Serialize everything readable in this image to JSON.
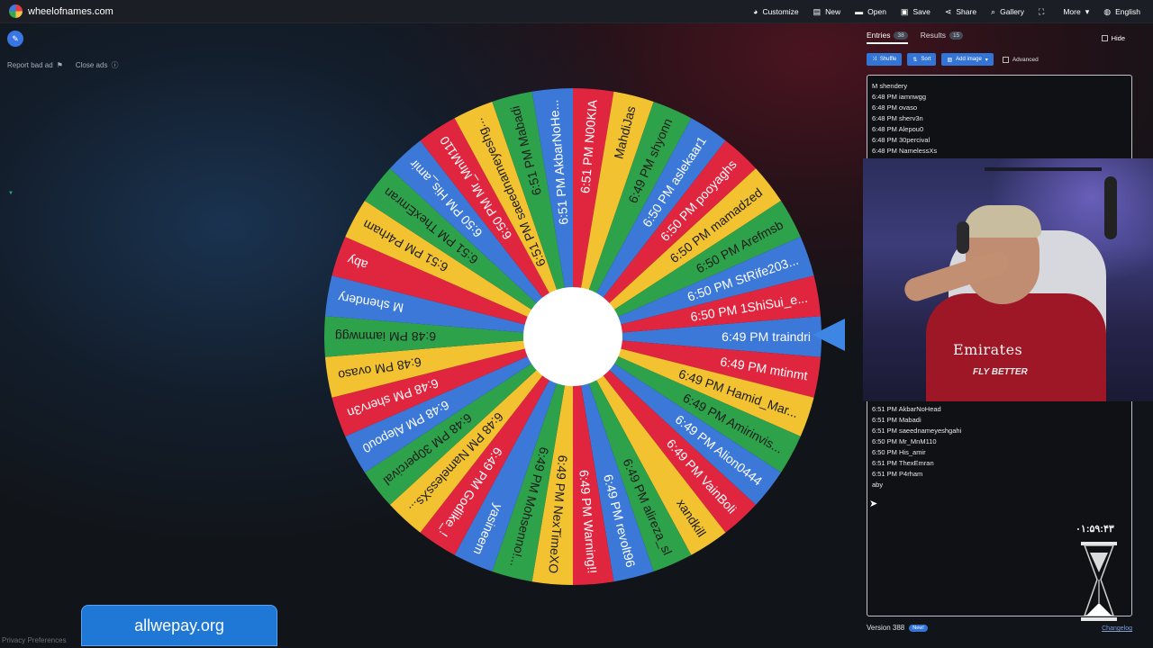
{
  "topbar": {
    "site_name": "wheelofnames.com",
    "menu": [
      {
        "label": "Customize",
        "icon": "palette-icon",
        "glyph": "◕"
      },
      {
        "label": "New",
        "icon": "document-icon",
        "glyph": "▤"
      },
      {
        "label": "Open",
        "icon": "folder-icon",
        "glyph": "▬"
      },
      {
        "label": "Save",
        "icon": "save-icon",
        "glyph": "▣"
      },
      {
        "label": "Share",
        "icon": "share-icon",
        "glyph": "⋖"
      },
      {
        "label": "Gallery",
        "icon": "search-icon",
        "glyph": "⌕"
      },
      {
        "label": "",
        "icon": "fullscreen-icon",
        "glyph": "⛶"
      },
      {
        "label": "More",
        "icon": "chevron-down-icon",
        "glyph": "▾"
      },
      {
        "label": "English",
        "icon": "globe-icon",
        "glyph": "◍"
      }
    ]
  },
  "left": {
    "report_label": "Report bad ad",
    "close_ads_label": "Close ads"
  },
  "wheel": {
    "pointer_color": "#3d86e4",
    "colors": [
      "#3b78d8",
      "#e0263f",
      "#f2c230",
      "#2ea14b"
    ],
    "segments": [
      "6:49 PM traindri",
      "6:49 PM mtinmt",
      "6:49 PM Hamid_Mar...",
      "6:49 PM Amirinvis...",
      "6:49 PM Alion0444",
      "6:49 PM VainBoli",
      "xandkill",
      "6:49 PM alireza_sl",
      "6:49 PM revolt96",
      "6:49 PM Warning!!",
      "6:49 PM NexTimeXO",
      "6:49 PM Mohsenno!...",
      "yasineem",
      "6:49 PM Godlike_!",
      "6:48 PM NamelessXs...",
      "6:48 PM 30percival",
      "6:48 PM Alepou0",
      "6:48 PM sherv3n",
      "6:48 PM ovaso",
      "6:48 PM iamnwgg",
      "M shendery",
      "aby",
      "6:51 PM P4rham",
      "6:51 PM ThexEmran",
      "6:50 PM His_amir",
      "6:50 PM Mr_MnM110",
      "6:51 PM saeednameyeshg...",
      "6:51 PM Mabadi",
      "6:51 PM AkbarNoHe...",
      "6:51 PM N00KIA",
      "MahdiJas",
      "6:49 PM shyonn",
      "6:50 PM aslekaar1",
      "6:50 PM pooyaghs",
      "6:50 PM mamadzed",
      "6:50 PM Arefmsb",
      "6:50 PM StRife203...",
      "6:50 PM 1ShiSui_e..."
    ]
  },
  "panel": {
    "tabs": [
      {
        "label": "Entries",
        "count": "38"
      },
      {
        "label": "Results",
        "count": "15"
      }
    ],
    "hide_label": "Hide",
    "toolbar": {
      "shuffle": "Shuffle",
      "sort": "Sort",
      "add_image": "Add image",
      "advanced": "Advanced"
    },
    "entries_top": [
      "M shendery",
      "6:48 PM iamnwgg",
      "6:48 PM ovaso",
      "6:48 PM sherv3n",
      "6:48 PM Alepou0",
      "6:48 PM 30percival",
      "6:48 PM NamelessXs"
    ],
    "entries_bottom": [
      "6:51 PM AkbarNoHead",
      "6:51 PM Mabadi",
      "6:51 PM saeednameyeshgahi",
      "6:50 PM Mr_MnM110",
      "6:50 PM His_amir",
      "6:51 PM ThexEmran",
      "6:51 PM P4rham",
      "aby"
    ],
    "version": "Version 388",
    "new_badge": "New!",
    "changelog": "Changelog"
  },
  "webcam": {
    "shirt_text": "Emirates",
    "shirt_text2": "FLY BETTER"
  },
  "overlay": {
    "timer": "۰۱:۵۹:۴۳"
  },
  "ad_banner": "allwepay.org",
  "privacy": "Privacy Preferences"
}
